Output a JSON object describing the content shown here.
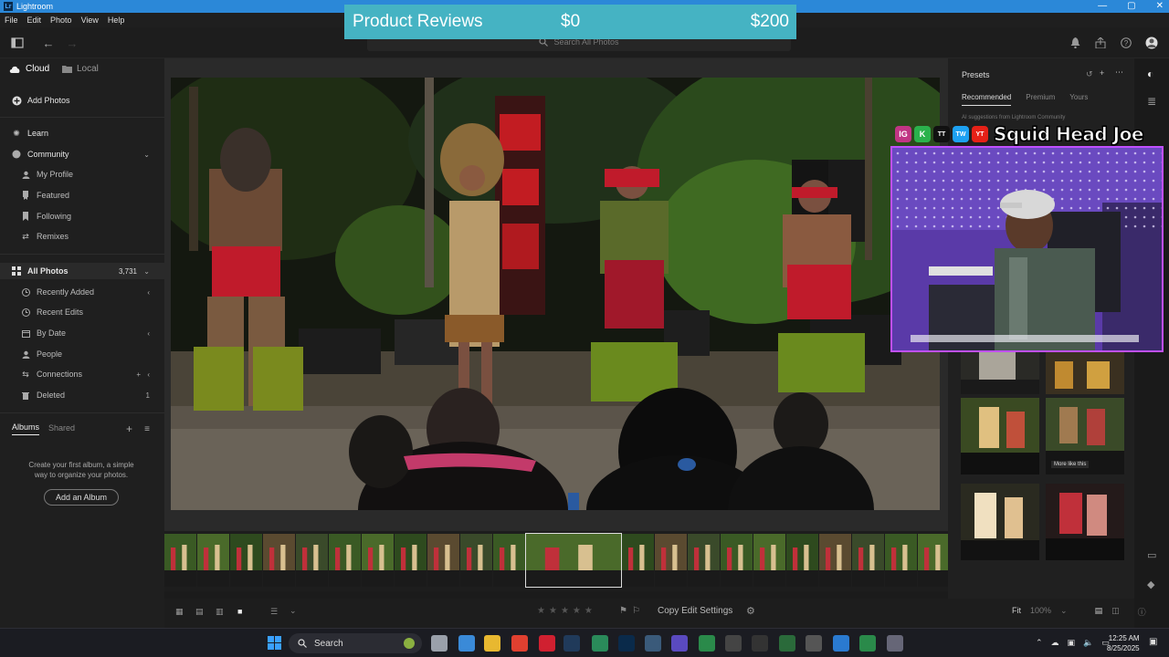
{
  "window": {
    "title": "Lightroom",
    "logo_text": "Lr",
    "min_icon": "—",
    "max_icon": "▢",
    "close_icon": "✕"
  },
  "menu": [
    "File",
    "Edit",
    "Photo",
    "View",
    "Help"
  ],
  "banner": {
    "title": "Product Reviews",
    "min": "$0",
    "max": "$200"
  },
  "search": {
    "placeholder": "Search All Photos"
  },
  "left_panel": {
    "cloud_tab": "Cloud",
    "local_tab": "Local",
    "add_photos": "Add Photos",
    "learn": "Learn",
    "community": "Community",
    "community_items": [
      "My Profile",
      "Featured",
      "Following",
      "Remixes"
    ],
    "all_photos": "All Photos",
    "all_photos_count": "3,731",
    "library_items": [
      "Recently Added",
      "Recent Edits",
      "By Date",
      "People",
      "Connections",
      "Deleted"
    ],
    "deleted_count": "1",
    "albums_tab": "Albums",
    "shared_tab": "Shared",
    "album_hint": "Create your first album, a simple way to organize your photos.",
    "add_album": "Add an Album"
  },
  "right_panel": {
    "title": "Presets",
    "tabs": [
      "Recommended",
      "Premium",
      "Yours"
    ],
    "hint": "AI suggestions from   Lightroom Community",
    "tooltip": "More like this"
  },
  "webcam": {
    "handle": "Squid Head Joe",
    "social": [
      "IG",
      "K",
      "TT",
      "TW",
      "YT"
    ]
  },
  "bottom": {
    "copy_settings": "Copy Edit Settings",
    "fit": "Fit",
    "zoom": "100%"
  },
  "taskbar": {
    "search": "Search",
    "time": "12:25 AM",
    "date": "8/25/2025"
  },
  "colors": {
    "accent": "#2b88d8",
    "banner": "#45b3c3",
    "webcam_border": "#c050ff"
  }
}
